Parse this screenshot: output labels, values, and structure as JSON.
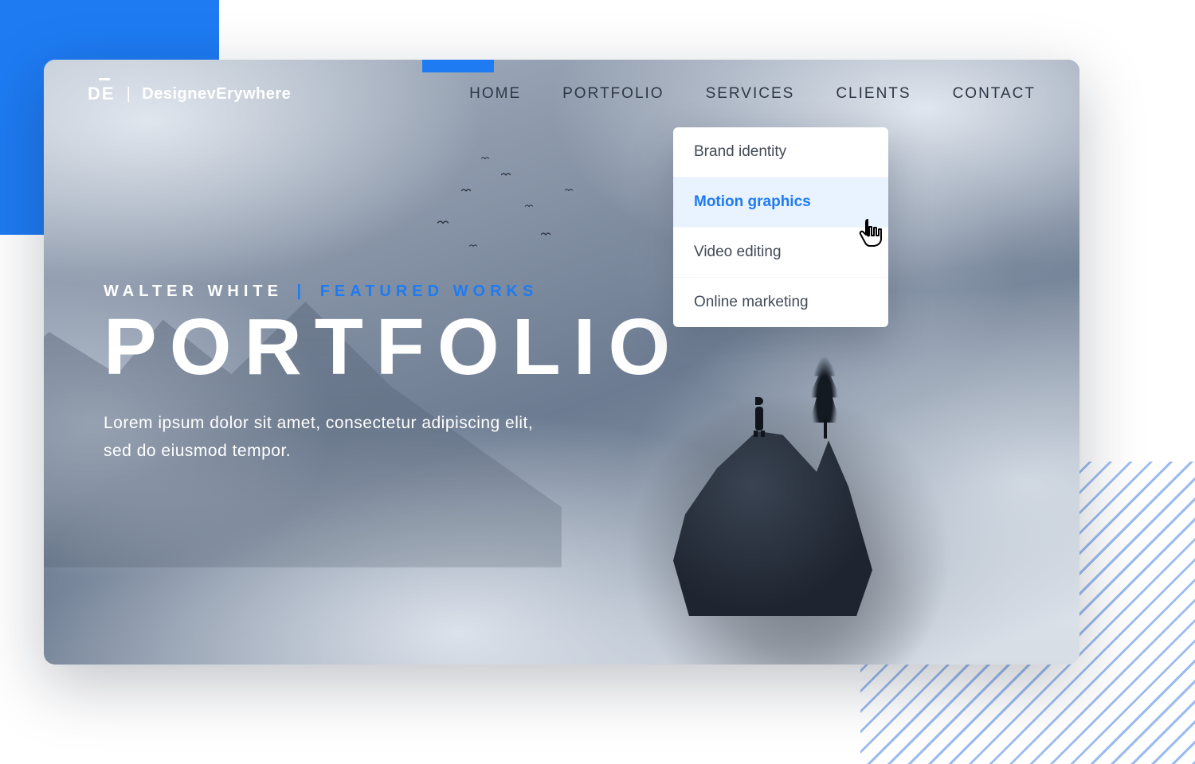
{
  "colors": {
    "accent": "#1e7bf2"
  },
  "header": {
    "logo_mark": "DE",
    "logo_name": "DesignevErywhere",
    "nav": [
      {
        "label": "HOME"
      },
      {
        "label": "PORTFOLIO"
      },
      {
        "label": "SERVICES"
      },
      {
        "label": "CLIENTS"
      },
      {
        "label": "CONTACT"
      }
    ]
  },
  "dropdown": {
    "items": [
      {
        "label": "Brand identity",
        "highlighted": false
      },
      {
        "label": "Motion graphics",
        "highlighted": true
      },
      {
        "label": "Video editing",
        "highlighted": false
      },
      {
        "label": "Online marketing",
        "highlighted": false
      }
    ]
  },
  "hero": {
    "eyebrow_primary": "WALTER WHITE",
    "eyebrow_separator": "|",
    "eyebrow_accent": "FEATURED WORKS",
    "title": "PORTFOLIO",
    "subtitle": "Lorem ipsum dolor sit amet, consectetur adipiscing elit, sed do eiusmod tempor."
  }
}
